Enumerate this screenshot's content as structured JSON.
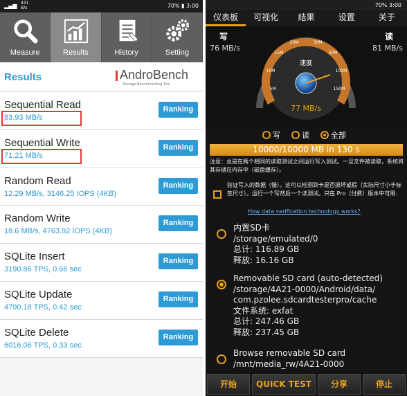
{
  "left": {
    "status": {
      "left": "4G",
      "mini": "431\nB/s",
      "right": "70% ▮ 3:00"
    },
    "tabs": [
      {
        "label": "Measure",
        "icon": "search-icon"
      },
      {
        "label": "Results",
        "icon": "chart-icon"
      },
      {
        "label": "History",
        "icon": "document-icon"
      },
      {
        "label": "Setting",
        "icon": "gear-icon"
      }
    ],
    "header": {
      "title": "Results",
      "logo": "AndroBench",
      "logo_sub": "Storage Benchmarking Tool"
    },
    "ranking_label": "Ranking",
    "rows": [
      {
        "name": "Sequential Read",
        "value": "83.93 MB/s"
      },
      {
        "name": "Sequential Write",
        "value": "71.21 MB/s"
      },
      {
        "name": "Random Read",
        "value": "12.29 MB/s, 3146.25 IOPS (4KB)"
      },
      {
        "name": "Random Write",
        "value": "18.6 MB/s, 4763.92 IOPS (4KB)"
      },
      {
        "name": "SQLite Insert",
        "value": "3190.86 TPS, 0.66 sec"
      },
      {
        "name": "SQLite Update",
        "value": "4790.18 TPS, 0.42 sec"
      },
      {
        "name": "SQLite Delete",
        "value": "6016.06 TPS, 0.33 sec"
      }
    ],
    "colors": {
      "accent": "#2e9bd6",
      "highlight": "#e53935"
    }
  },
  "right": {
    "status": "70% 3:00",
    "tabs": [
      "仪表板",
      "可视化",
      "结果",
      "设置",
      "关于"
    ],
    "gauge": {
      "write_label": "写",
      "write_value": "76 MB/s",
      "read_label": "读",
      "read_value": "81 MB/s",
      "center_label": "速度",
      "speed": "77 MB/s",
      "ticks": [
        "5M",
        "10M",
        "15M",
        "20M",
        "30M",
        "50M",
        "100M",
        "150M"
      ]
    },
    "radios": [
      {
        "label": "写",
        "selected": false
      },
      {
        "label": "读",
        "selected": false
      },
      {
        "label": "全部",
        "selected": true
      }
    ],
    "progress": {
      "text": "10000/10000 MB in 130 s",
      "fraction": 1.0
    },
    "note": "注意：总是在两个相同的读取测试之间运行写入测试。一旦文件被读取，系统将其存储在内存中（磁盘缓存）。",
    "verify": {
      "text": "验证写入的数据（慢）。这可以检测到卡是否损坏或假（实际尺寸小于标签尺寸）。运行一个写然后一个读测试。只在 Pro（付费）版本中可用.",
      "link": "How data verification technology works?"
    },
    "storages": [
      {
        "selected": false,
        "lines": [
          "内置SD卡",
          "/storage/emulated/0",
          "总计: 116.89 GB",
          "释放: 16.16 GB"
        ]
      },
      {
        "selected": true,
        "lines": [
          "Removable SD card (auto-detected)",
          "/storage/4A21-0000/Android/data/",
          "com.pzolee.sdcardtesterpro/cache",
          "文件系统: exfat",
          "总计: 247.46 GB",
          "释放: 237.45 GB"
        ]
      },
      {
        "selected": false,
        "lines": [
          "Browse removable SD card",
          "/mnt/media_rw/4A21-0000"
        ]
      }
    ],
    "buttons": [
      "开始",
      "QUICK TEST",
      "分享",
      "停止"
    ],
    "colors": {
      "accent": "#e6a021",
      "background": "#141414"
    }
  }
}
